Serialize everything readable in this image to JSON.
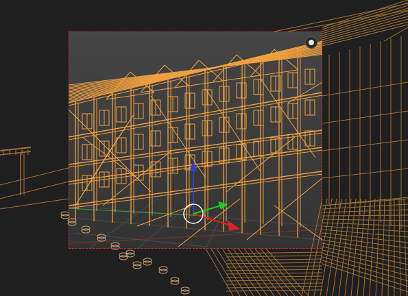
{
  "viewport": {
    "mode": "wireframe",
    "wire_color": "#f0a040",
    "wire_color_dim": "#b9803a",
    "background": "#1f1f1f",
    "region_background": "#3a3a3a",
    "region_border_color": "#d62e2e",
    "grid_color": "#4a4a4a",
    "x_axis_color": "#c0392b",
    "y_axis_color": "#3ba33b"
  },
  "gizmo": {
    "z_color": "#2f3fd8",
    "x_color": "#e02020",
    "y_color": "#22cc22",
    "ring_color": "#ffffff"
  },
  "icons": {
    "camera_toggle": "camera-view-icon"
  }
}
